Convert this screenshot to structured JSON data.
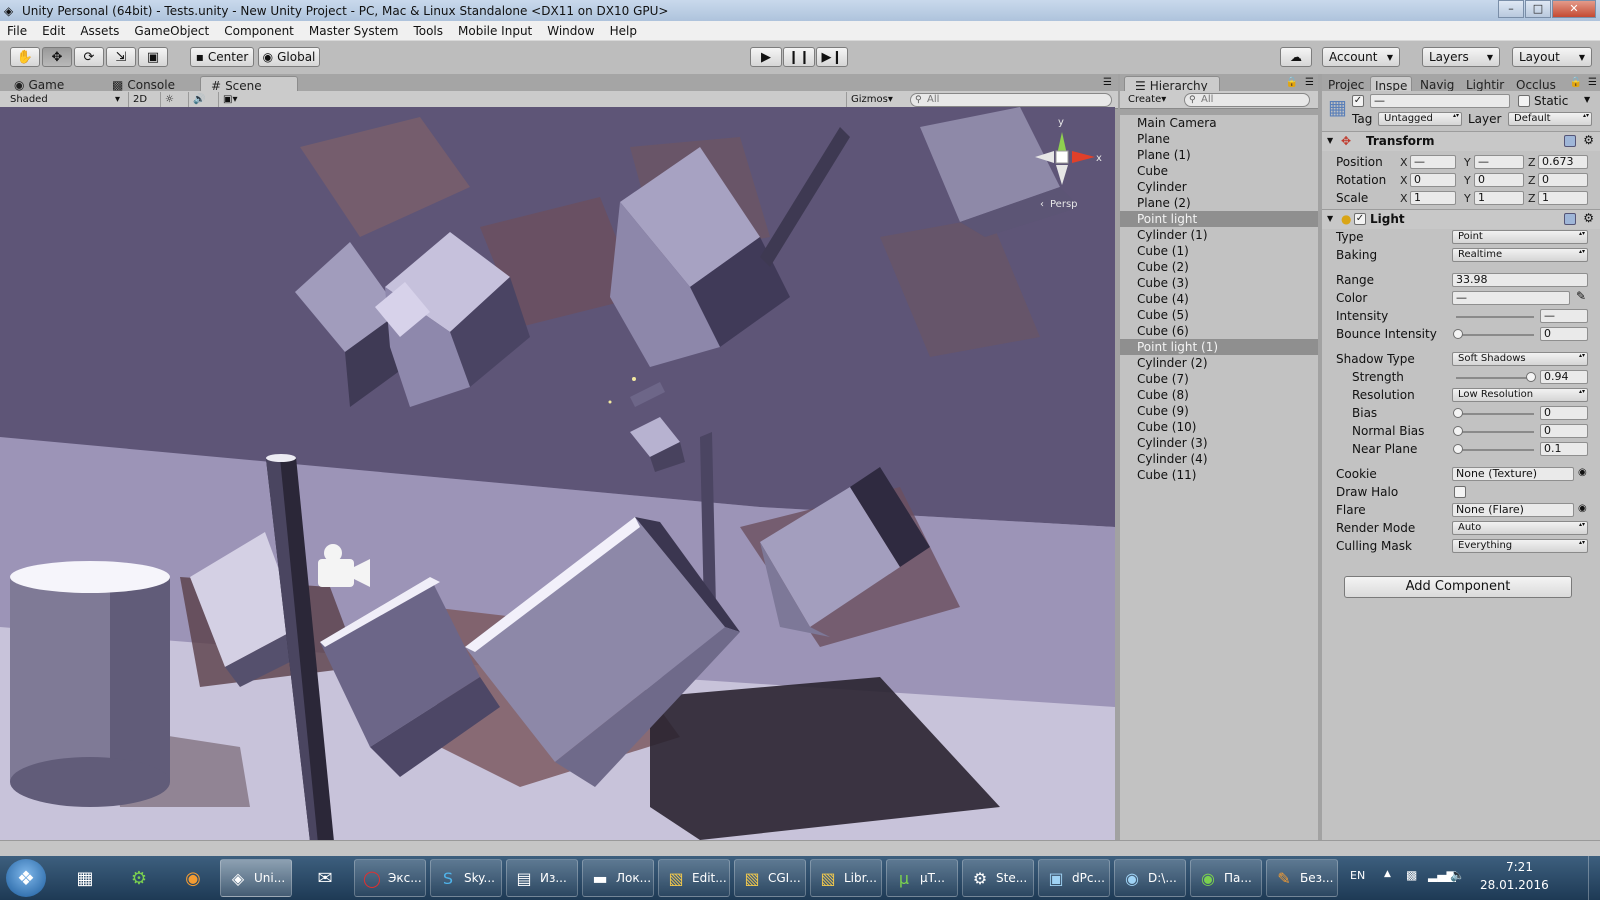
{
  "window": {
    "title": "Unity Personal (64bit) - Tests.unity - New Unity Project - PC, Mac & Linux Standalone <DX11 on DX10 GPU>",
    "controls": [
      "–",
      "□",
      "✕"
    ]
  },
  "menubar": [
    "File",
    "Edit",
    "Assets",
    "GameObject",
    "Component",
    "Master System",
    "Tools",
    "Mobile Input",
    "Window",
    "Help"
  ],
  "toolbar": {
    "pivot_mode": "Center",
    "pivot_rotation": "Global",
    "account": "Account",
    "layers": "Layers",
    "layout": "Layout"
  },
  "scene_tabs": [
    "Game",
    "Console",
    "Scene"
  ],
  "scene_toolbar": {
    "shading": "Shaded",
    "mode_2d": "2D",
    "gizmos": "Gizmos",
    "search_placeholder": "All"
  },
  "scene_view": {
    "gizmo_axes": {
      "y": "y",
      "x": "x"
    },
    "projection": "Persp",
    "projection_prefix": "‹"
  },
  "hierarchy": {
    "tab": "Hierarchy",
    "create": "Create",
    "search_placeholder": "All",
    "items": [
      "Main Camera",
      "Plane",
      "Plane (1)",
      "Cube",
      "Cylinder",
      "Plane (2)",
      "Point light",
      "Cylinder (1)",
      "Cube (1)",
      "Cube (2)",
      "Cube (3)",
      "Cube (4)",
      "Cube (5)",
      "Cube (6)",
      "Point light (1)",
      "Cylinder (2)",
      "Cube (7)",
      "Cube (8)",
      "Cube (9)",
      "Cube (10)",
      "Cylinder (3)",
      "Cylinder (4)",
      "Cube (11)"
    ],
    "selected": [
      "Point light",
      "Point light (1)"
    ]
  },
  "inspector": {
    "tabs": [
      "Projec",
      "Inspe",
      "Navig",
      "Lightir",
      "Occlus"
    ],
    "object_name": "—",
    "static_label": "Static",
    "tag_label": "Tag",
    "tag": "Untagged",
    "layer_label": "Layer",
    "layer": "Default",
    "transform": {
      "title": "Transform",
      "position_label": "Position",
      "position": {
        "x": "—",
        "y": "—",
        "z": "0.673"
      },
      "rotation_label": "Rotation",
      "rotation": {
        "x": "0",
        "y": "0",
        "z": "0"
      },
      "scale_label": "Scale",
      "scale": {
        "x": "1",
        "y": "1",
        "z": "1"
      },
      "axes": {
        "x": "X",
        "y": "Y",
        "z": "Z"
      }
    },
    "light": {
      "title": "Light",
      "type_label": "Type",
      "type": "Point",
      "baking_label": "Baking",
      "baking": "Realtime",
      "range_label": "Range",
      "range": "33.98",
      "color_label": "Color",
      "color": "—",
      "intensity_label": "Intensity",
      "intensity": "—",
      "bounce_label": "Bounce Intensity",
      "bounce": "0",
      "shadow_type_label": "Shadow Type",
      "shadow_type": "Soft Shadows",
      "strength_label": "Strength",
      "strength": "0.94",
      "resolution_label": "Resolution",
      "resolution": "Low Resolution",
      "bias_label": "Bias",
      "bias": "0",
      "normal_bias_label": "Normal Bias",
      "normal_bias": "0",
      "near_plane_label": "Near Plane",
      "near_plane": "0.1",
      "cookie_label": "Cookie",
      "cookie": "None (Texture)",
      "draw_halo_label": "Draw Halo",
      "flare_label": "Flare",
      "flare": "None (Flare)",
      "render_mode_label": "Render Mode",
      "render_mode": "Auto",
      "culling_mask_label": "Culling Mask",
      "culling_mask": "Everything"
    },
    "add_component": "Add Component"
  },
  "taskbar": {
    "tasks": [
      "Uni...",
      "Экс...",
      "Sky...",
      "Из...",
      "Лок...",
      "Edit...",
      "CGI...",
      "Libr...",
      "µT...",
      "Ste...",
      "dPc...",
      "D:\\...",
      "Па...",
      "Без..."
    ],
    "language": "EN",
    "time": "7:21",
    "date": "28.01.2016"
  },
  "colors": {
    "editor_bg": "#c2c2c2",
    "selection": "#8f8f8f",
    "scene_sky": "#5b5276",
    "floor_light": "#d8d5e6",
    "taskbar": "#1e3a55"
  }
}
